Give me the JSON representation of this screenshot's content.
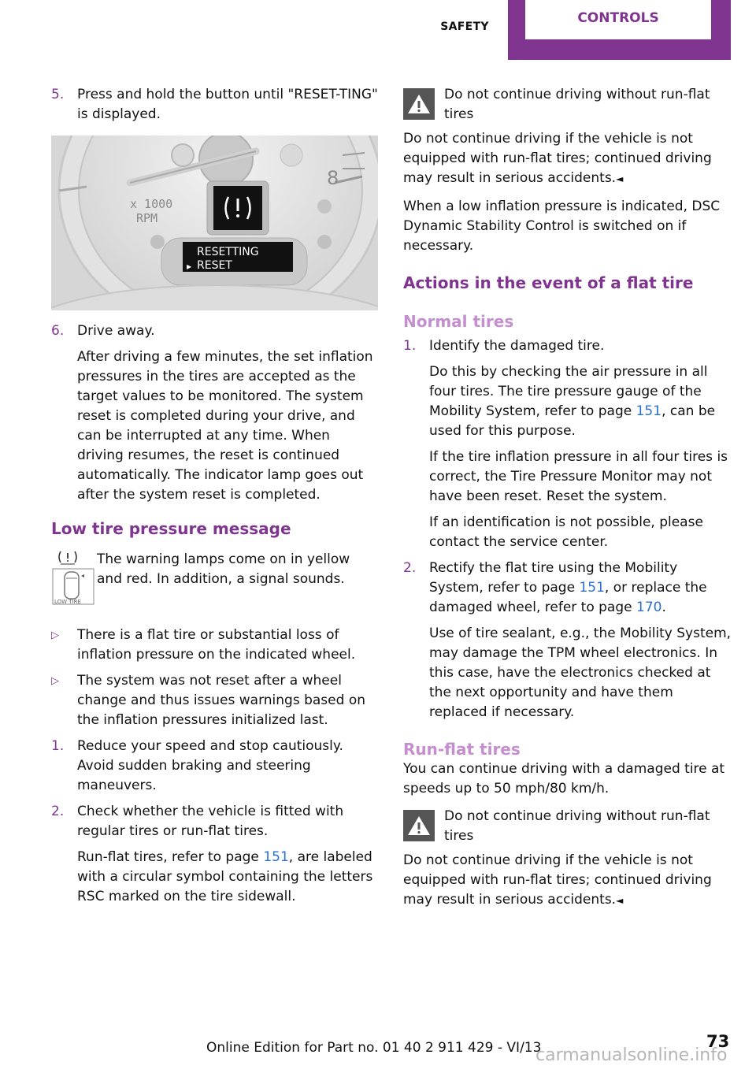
{
  "header": {
    "tabs": [
      {
        "label": "SAFETY",
        "active": false
      },
      {
        "label": "CONTROLS",
        "active": true
      }
    ],
    "accent_color": "#7f348f"
  },
  "left": {
    "step5": {
      "num": "5.",
      "text": "Press and hold the button until \"RESET-TING\" is displayed."
    },
    "figure": {
      "alt": "Instrument cluster showing tire pressure warning symbol and display",
      "gauge_unit_line1": "x 1000",
      "gauge_unit_line2": "RPM",
      "display_line1": "RESETTING",
      "display_line2": "RESET",
      "gauge_number": "8"
    },
    "step6": {
      "num": "6.",
      "title": "Drive away.",
      "text": "After driving a few minutes, the set inflation pressures in the tires are accepted as the target values to be monitored. The system reset is completed during your drive, and can be interrupted at any time. When driving resumes, the reset is continued automatically. The indicator lamp goes out after the system reset is completed."
    },
    "low_tire_heading": "Low tire pressure message",
    "low_tire_icon_label": "LOW TIRE",
    "low_tire_text": "The warning lamps come on in yellow and red. In addition, a signal sounds.",
    "bullets": [
      "There is a flat tire or substantial loss of inflation pressure on the indicated wheel.",
      "The system was not reset after a wheel change and thus issues warnings based on the inflation pressures initialized last."
    ],
    "steps": [
      {
        "num": "1.",
        "text": "Reduce your speed and stop cautiously. Avoid sudden braking and steering maneuvers."
      },
      {
        "num": "2.",
        "text": "Check whether the vehicle is fitted with regular tires or run-flat tires.",
        "sub_before": "Run-flat tires, refer to page ",
        "sub_link": "151",
        "sub_after": ", are labeled with a circular symbol containing the letters RSC marked on the tire sidewall."
      }
    ]
  },
  "right": {
    "warning1": {
      "title": "Do not continue driving without run-flat tires",
      "body": "Do not continue driving if the vehicle is not equipped with run-flat tires; continued driving may result in serious accidents.",
      "end_mark": "◄"
    },
    "dsc_text": "When a low inflation pressure is indicated, DSC Dynamic Stability Control is switched on if necessary.",
    "actions_heading": "Actions in the event of a flat tire",
    "normal_heading": "Normal tires",
    "normal_steps": [
      {
        "num": "1.",
        "title": "Identify the damaged tire.",
        "p1_before": "Do this by checking the air pressure in all four tires. The tire pressure gauge of the Mobility System, refer to page ",
        "p1_link": "151",
        "p1_after": ", can be used for this purpose.",
        "p2": "If the tire inflation pressure in all four tires is correct, the Tire Pressure Monitor may not have been reset. Reset the system.",
        "p3": "If an identification is not possible, please contact the service center."
      },
      {
        "num": "2.",
        "t_before": "Rectify the flat tire using the Mobility System, refer to page ",
        "t_link1": "151",
        "t_mid": ", or replace the damaged wheel, refer to page ",
        "t_link2": "170",
        "t_after": ".",
        "p2": "Use of tire sealant, e.g., the Mobility System, may damage the TPM wheel electronics. In this case, have the electronics checked at the next opportunity and have them replaced if necessary."
      }
    ],
    "runflat_heading": "Run-flat tires",
    "runflat_text": "You can continue driving with a damaged tire at speeds up to 50 mph/80 km/h.",
    "warning2": {
      "title": "Do not continue driving without run-flat tires",
      "body": "Do not continue driving if the vehicle is not equipped with run-flat tires; continued driving may result in serious accidents.",
      "end_mark": "◄"
    }
  },
  "footer": {
    "edition": "Online Edition for Part no. 01 40 2 911 429 - VI/13",
    "page_number": "73",
    "watermark": "carmanualsonline.info"
  }
}
